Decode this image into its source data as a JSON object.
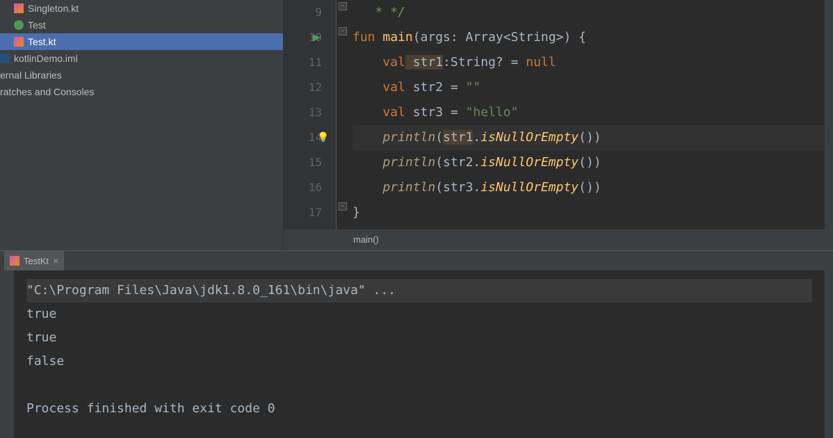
{
  "sidebar": {
    "items": [
      {
        "label": "Singleton.kt",
        "indent": "indent1"
      },
      {
        "label": "Test",
        "indent": "indent1"
      },
      {
        "label": "Test.kt",
        "indent": "indent1",
        "selected": true
      },
      {
        "label": "kotlinDemo.iml",
        "indent": "indent2"
      },
      {
        "label": "ernal Libraries",
        "indent": "indent2"
      },
      {
        "label": "ratches and Consoles",
        "indent": "indent2"
      }
    ]
  },
  "gutter": {
    "lines": [
      "9",
      "10",
      "11",
      "12",
      "13",
      "14",
      "15",
      "16",
      "17"
    ]
  },
  "code": {
    "l9": "   * */",
    "l10_fun": "fun",
    "l10_main": " main",
    "l10_rest": "(args: Array<String>) {",
    "l11_val": "    val",
    "l11_var": " str1",
    "l11_rest1": ":String? = ",
    "l11_null": "null",
    "l12_val": "    val",
    "l12_rest": " str2 = ",
    "l12_str": "\"\"",
    "l13_val": "    val",
    "l13_rest": " str3 = ",
    "l13_str": "\"hello\"",
    "l14_fn": "    println",
    "l14_open": "(",
    "l14_var": "str1",
    "l14_dot": ".",
    "l14_method": "isNullOrEmpty",
    "l14_close": "())",
    "l15_fn": "    println",
    "l15_rest": "(str2.",
    "l15_method": "isNullOrEmpty",
    "l15_close": "())",
    "l16_fn": "    println",
    "l16_rest": "(str3.",
    "l16_method": "isNullOrEmpty",
    "l16_close": "())",
    "l17": "}"
  },
  "breadcrumb": "main()",
  "runTab": {
    "label": "TestKt",
    "close": "×"
  },
  "console": {
    "cmd": "\"C:\\Program Files\\Java\\jdk1.8.0_161\\bin\\java\" ...",
    "out1": "true",
    "out2": "true",
    "out3": "false",
    "exit": "Process finished with exit code 0"
  }
}
